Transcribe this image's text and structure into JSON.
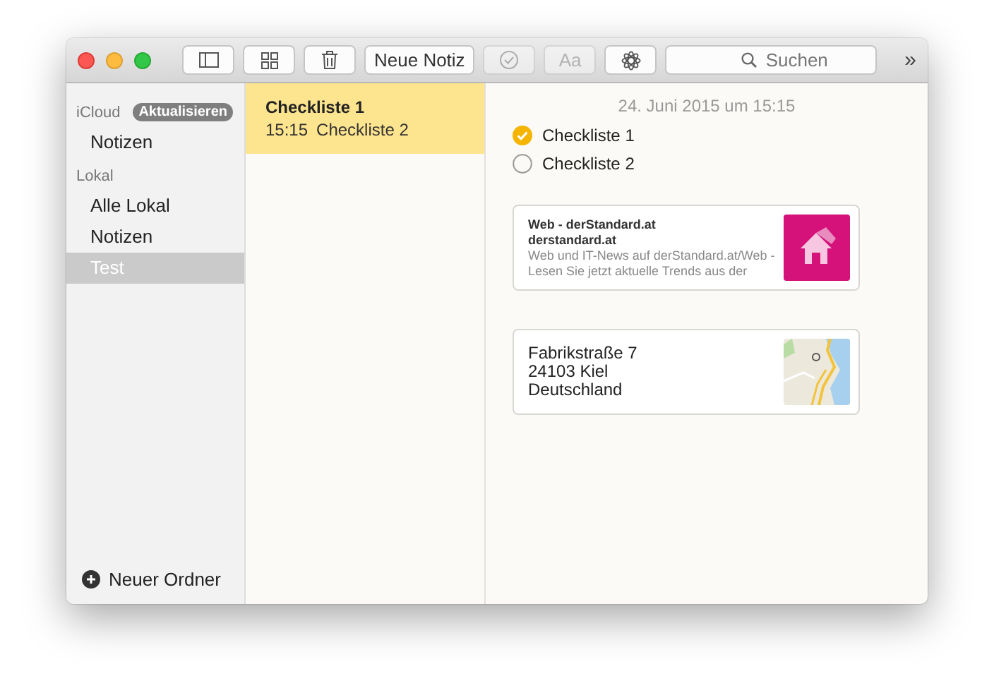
{
  "toolbar": {
    "new_note": "Neue Notiz",
    "format_label": "Aa",
    "format_disabled": true,
    "checklist_disabled": true,
    "search": {
      "placeholder": "Suchen"
    },
    "overflow": "»"
  },
  "sidebar": {
    "sections": [
      {
        "title": "iCloud",
        "badge": "Aktualisieren",
        "items": [
          {
            "label": "Notizen",
            "selected": false
          }
        ]
      },
      {
        "title": "Lokal",
        "items": [
          {
            "label": "Alle Lokal",
            "selected": false
          },
          {
            "label": "Notizen",
            "selected": false
          },
          {
            "label": "Test",
            "selected": true
          }
        ]
      }
    ],
    "new_folder": "Neuer Ordner"
  },
  "notes": [
    {
      "title": "Checkliste 1",
      "time": "15:15",
      "preview": "Checkliste 2",
      "selected": true
    }
  ],
  "note": {
    "date": "24. Juni 2015 um 15:15",
    "checklist": [
      {
        "label": "Checkliste 1",
        "checked": true
      },
      {
        "label": "Checkliste 2",
        "checked": false
      }
    ],
    "attachments": [
      {
        "kind": "link",
        "title": "Web - derStandard.at",
        "site": "derstandard.at",
        "description": "Web und IT-News auf derStandard.at/Web - Lesen Sie jetzt aktuelle Trends aus der"
      },
      {
        "kind": "map",
        "lines": [
          "Fabrikstraße 7",
          "24103 Kiel",
          "Deutschland"
        ]
      }
    ]
  }
}
